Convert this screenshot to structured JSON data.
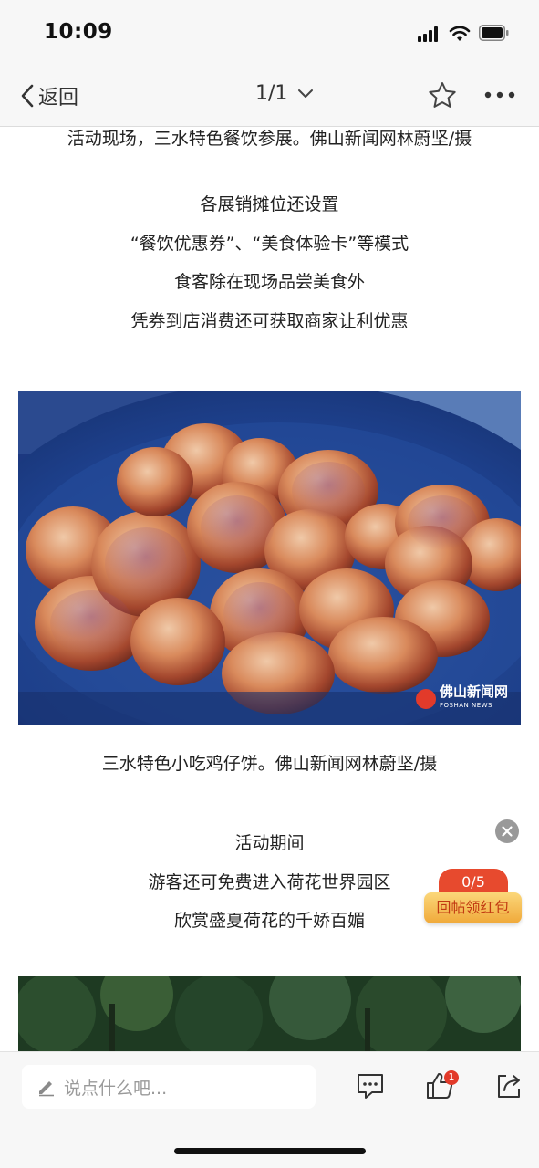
{
  "status_bar": {
    "time": "10:09"
  },
  "nav": {
    "back_label": "返回",
    "page_indicator": "1/1"
  },
  "article": {
    "caption_top": "活动现场，三水特色餐饮参展。佛山新闻网林蔚坚/摄",
    "block1": [
      "各展销摊位还设置",
      "“餐饮优惠券”、“美食体验卡”等模式",
      "食客除在现场品尝美食外",
      "凭券到店消费还可获取商家让利优惠"
    ],
    "photo1_watermark": {
      "name": "佛山新闻网",
      "sub": "FOSHAN NEWS"
    },
    "caption_photo1": "三水特色小吃鸡仔饼。佛山新闻网林蔚坚/摄",
    "block2": [
      "活动期间",
      "游客还可免费进入荷花世界园区",
      "欣赏盛夏荷花的千娇百媚"
    ]
  },
  "redpack": {
    "count": "0/5",
    "button_label": "回帖领红包"
  },
  "bottom_bar": {
    "comment_placeholder": "说点什么吧...",
    "like_count": "1"
  },
  "colors": {
    "accent_red": "#e23a2a",
    "redpack_gold": "#f0a93a",
    "bar_background": "#f7f7f7"
  },
  "icons": [
    "back-chevron-icon",
    "chevron-down-icon",
    "star-icon",
    "more-dots-icon",
    "pencil-icon",
    "comment-icon",
    "thumbs-up-icon",
    "share-icon",
    "close-icon",
    "signal-icon",
    "wifi-icon",
    "battery-icon"
  ]
}
